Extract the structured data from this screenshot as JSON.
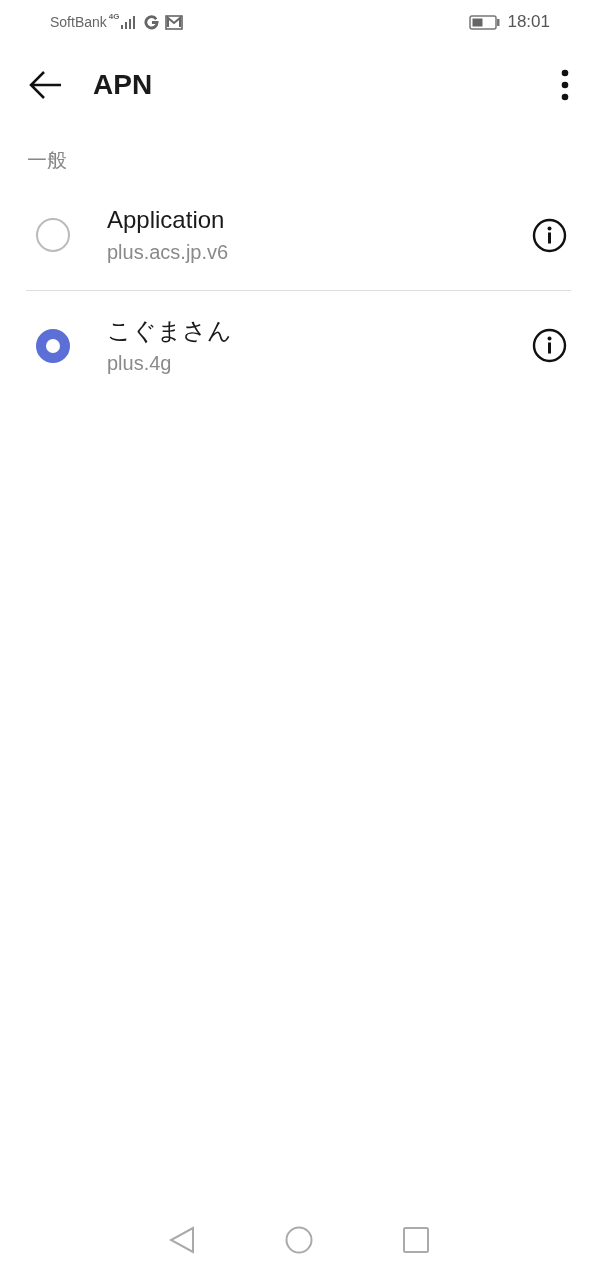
{
  "status_bar": {
    "carrier": "SoftBank",
    "network": "4G",
    "time": "18:01"
  },
  "app_bar": {
    "title": "APN"
  },
  "section": {
    "header": "一般"
  },
  "apns": [
    {
      "name": "Application",
      "apn": "plus.acs.jp.v6",
      "selected": false
    },
    {
      "name": "こぐまさん",
      "apn": "plus.4g",
      "selected": true
    }
  ]
}
